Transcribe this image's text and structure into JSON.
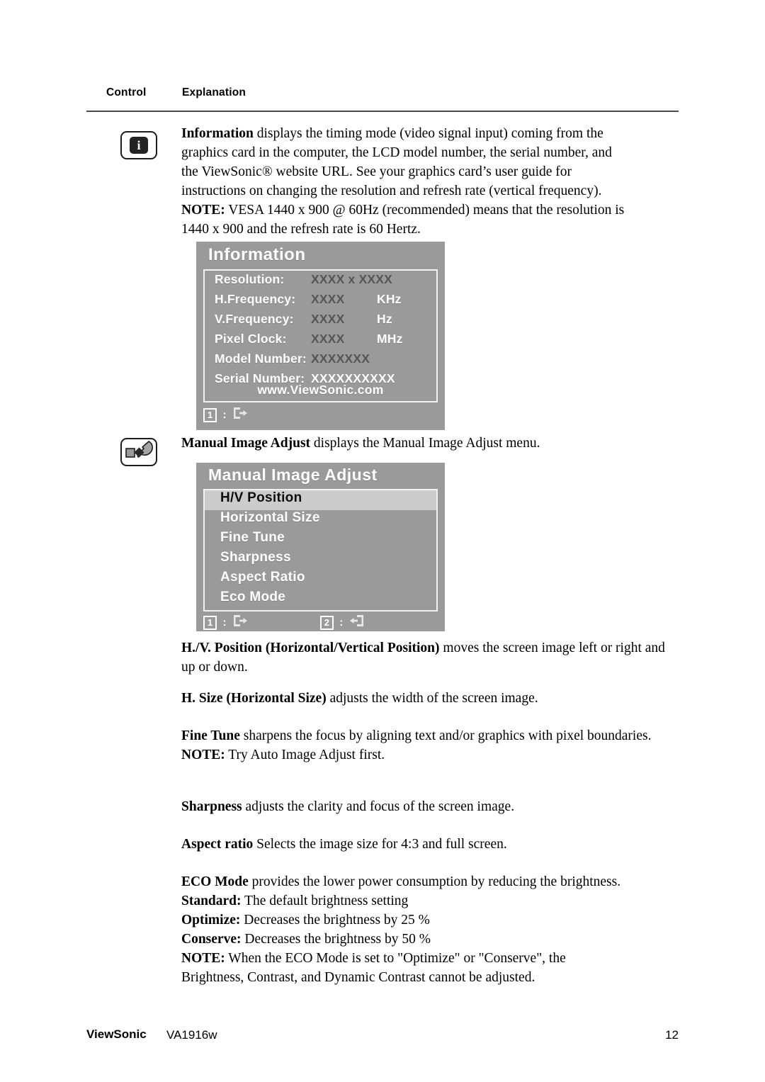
{
  "header": {
    "col_control": "Control",
    "col_explanation": "Explanation"
  },
  "sections": {
    "information": {
      "icon_name": "information-icon",
      "icon_glyph": "i",
      "paragraph_lines": [
        "Information displays the timing mode (video signal input) coming from the",
        "graphics card in the computer, the LCD model number, the serial number, and",
        "the ViewSonic® website URL. See your graphics card’s user guide for",
        "instructions on changing the resolution and refresh rate (vertical frequency).",
        "NOTE: VESA 1440 x 900 @ 60Hz (recommended) means that the resolution is",
        "1440 x 900 and the refresh rate is 60 Hertz."
      ],
      "bold_lead": "Information",
      "note_lead": "NOTE:"
    },
    "manual_image_adjust": {
      "icon_name": "wrench-icon",
      "paragraph": "Manual Image Adjust displays the Manual Image Adjust menu.",
      "bold_lead": "Manual Image Adjust",
      "rest": " displays the Manual Image Adjust menu."
    }
  },
  "osd_information": {
    "title": "Information",
    "rows": [
      {
        "label": "Resolution:",
        "value": "XXXX x XXXX",
        "unit": "",
        "value_light": false
      },
      {
        "label": "H.Frequency:",
        "value": "XXXX",
        "unit": "KHz",
        "value_light": false
      },
      {
        "label": "V.Frequency:",
        "value": "XXXX",
        "unit": "Hz",
        "value_light": false
      },
      {
        "label": "Pixel Clock:",
        "value": "XXXX",
        "unit": "MHz",
        "value_light": false
      },
      {
        "label": "Model Number:",
        "value": "XXXXXXX",
        "unit": "",
        "value_light": false
      },
      {
        "label": "Serial Number:",
        "value": "XXXXXXXXXX",
        "unit": "",
        "value_light": true
      }
    ],
    "url": "www.ViewSonic.com",
    "footer_keys": [
      {
        "key": "1",
        "sep": ":",
        "icon": "exit-right-icon"
      }
    ]
  },
  "osd_manual_image_adjust": {
    "title": "Manual Image Adjust",
    "items": [
      {
        "label": "H/V Position",
        "selected": true
      },
      {
        "label": "Horizontal Size",
        "selected": false
      },
      {
        "label": "Fine Tune",
        "selected": false
      },
      {
        "label": "Sharpness",
        "selected": false
      },
      {
        "label": "Aspect Ratio",
        "selected": false
      },
      {
        "label": "Eco Mode",
        "selected": false
      }
    ],
    "footer_keys": [
      {
        "key": "1",
        "sep": ":",
        "icon": "exit-right-icon"
      },
      {
        "key": "2",
        "sep": ":",
        "icon": "enter-left-icon"
      }
    ]
  },
  "body_paragraphs": {
    "hv_position": {
      "bold_lead": "H./V. Position (Horizontal/Vertical Position)",
      "rest": " moves the screen image left or right and up or down."
    },
    "h_size": {
      "bold_lead": "H. Size (Horizontal Size)",
      "rest": " adjusts the width of the screen image."
    },
    "fine_tune": {
      "bold_lead": "Fine Tune",
      "rest": " sharpens the focus by aligning text and/or graphics with pixel boundaries.",
      "note_lead": "NOTE:",
      "note_rest": " Try Auto Image Adjust first."
    },
    "sharpness": {
      "bold_lead": "Sharpness",
      "rest": " adjusts the clarity and focus of the screen image."
    },
    "aspect_ratio": {
      "bold_lead": "Aspect ratio",
      "rest": " Selects the image size for 4:3 and full screen."
    },
    "eco_mode": {
      "bold_lead": "ECO Mode",
      "rest": " provides the lower power consumption by reducing the brightness.",
      "standard_lead": "Standard:",
      "standard_rest": " The default brightness setting",
      "optimize_lead": "Optimize:",
      "optimize_rest": " Decreases the brightness by 25 %",
      "conserve_lead": "Conserve:",
      "conserve_rest": " Decreases the brightness by 50 %",
      "note_lead": "NOTE:",
      "note_rest_line1": " When the ECO Mode is set to \"Optimize\" or \"Conserve\", the",
      "note_rest_line2": "Brightness, Contrast, and Dynamic Contrast cannot be adjusted."
    }
  },
  "footer": {
    "brand": "ViewSonic",
    "model": "VA1916w",
    "page_number": "12"
  },
  "colors": {
    "osd_background": "#9a9a9a",
    "osd_border": "#f2f2f2",
    "osd_selected": "#cccccc",
    "osd_value": "#565656",
    "rule": "#4a4a4a"
  }
}
